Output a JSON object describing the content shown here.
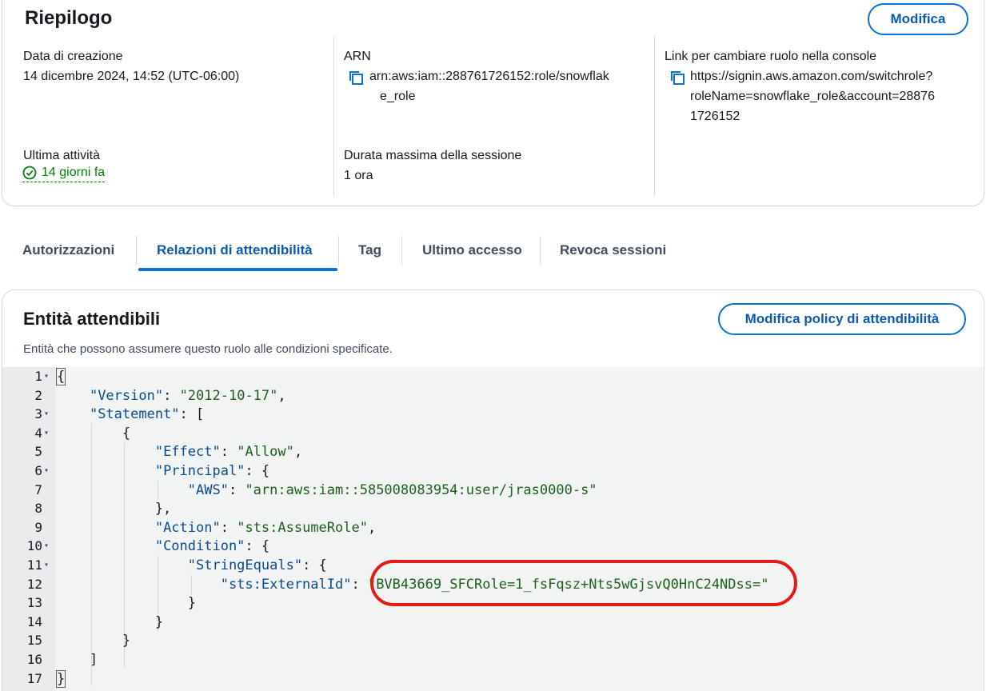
{
  "summary": {
    "title": "Riepilogo",
    "edit_label": "Modifica",
    "creation_date_label": "Data di creazione",
    "creation_date_value": "14 dicembre 2024, 14:52 (UTC-06:00)",
    "arn_label": "ARN",
    "arn_line1": "arn:aws:iam::288761726152:role/snowflak",
    "arn_line2": "e_role",
    "switch_role_label": "Link per cambiare ruolo nella console",
    "switch_role_line1": "https://signin.aws.amazon.com/switchrole?",
    "switch_role_line2": "roleName=snowflake_role&account=28876",
    "switch_role_line3": "1726152",
    "last_activity_label": "Ultima attività",
    "last_activity_value": "14 giorni fa",
    "max_session_label": "Durata massima della sessione",
    "max_session_value": "1 ora"
  },
  "tabs": [
    {
      "label": "Autorizzazioni"
    },
    {
      "label": "Relazioni di attendibilità"
    },
    {
      "label": "Tag"
    },
    {
      "label": "Ultimo accesso"
    },
    {
      "label": "Revoca sessioni"
    }
  ],
  "trust": {
    "title": "Entità attendibili",
    "description": "Entità che possono assumere questo ruolo alle condizioni specificate.",
    "edit_policy_label": "Modifica policy di attendibilità"
  },
  "code_lines": [
    {
      "n": "1",
      "fold": true
    },
    {
      "n": "2",
      "fold": false
    },
    {
      "n": "3",
      "fold": true
    },
    {
      "n": "4",
      "fold": true
    },
    {
      "n": "5",
      "fold": false
    },
    {
      "n": "6",
      "fold": true
    },
    {
      "n": "7",
      "fold": false
    },
    {
      "n": "8",
      "fold": false
    },
    {
      "n": "9",
      "fold": false
    },
    {
      "n": "10",
      "fold": true
    },
    {
      "n": "11",
      "fold": true
    },
    {
      "n": "12",
      "fold": false
    },
    {
      "n": "13",
      "fold": false
    },
    {
      "n": "14",
      "fold": false
    },
    {
      "n": "15",
      "fold": false
    },
    {
      "n": "16",
      "fold": false
    },
    {
      "n": "17",
      "fold": false
    }
  ],
  "policy": {
    "version_key": "\"Version\"",
    "version_value": "\"2012-10-17\"",
    "statement_key": "\"Statement\"",
    "effect_key": "\"Effect\"",
    "effect_value": "\"Allow\"",
    "principal_key": "\"Principal\"",
    "aws_key": "\"AWS\"",
    "aws_value": "\"arn:aws:iam::585008083954:user/jras0000-s\"",
    "action_key": "\"Action\"",
    "action_value": "\"sts:AssumeRole\"",
    "condition_key": "\"Condition\"",
    "string_equals_key": "\"StringEquals\"",
    "external_id_key": "\"sts:ExternalId\"",
    "external_id_value": "\"BVB43669_SFCRole=1_fsFqsz+Nts5wGjsvQ0HnC24NDss=\""
  },
  "colors": {
    "accent": "#0972d3",
    "success": "#037f0c",
    "highlight": "#e41b17"
  }
}
